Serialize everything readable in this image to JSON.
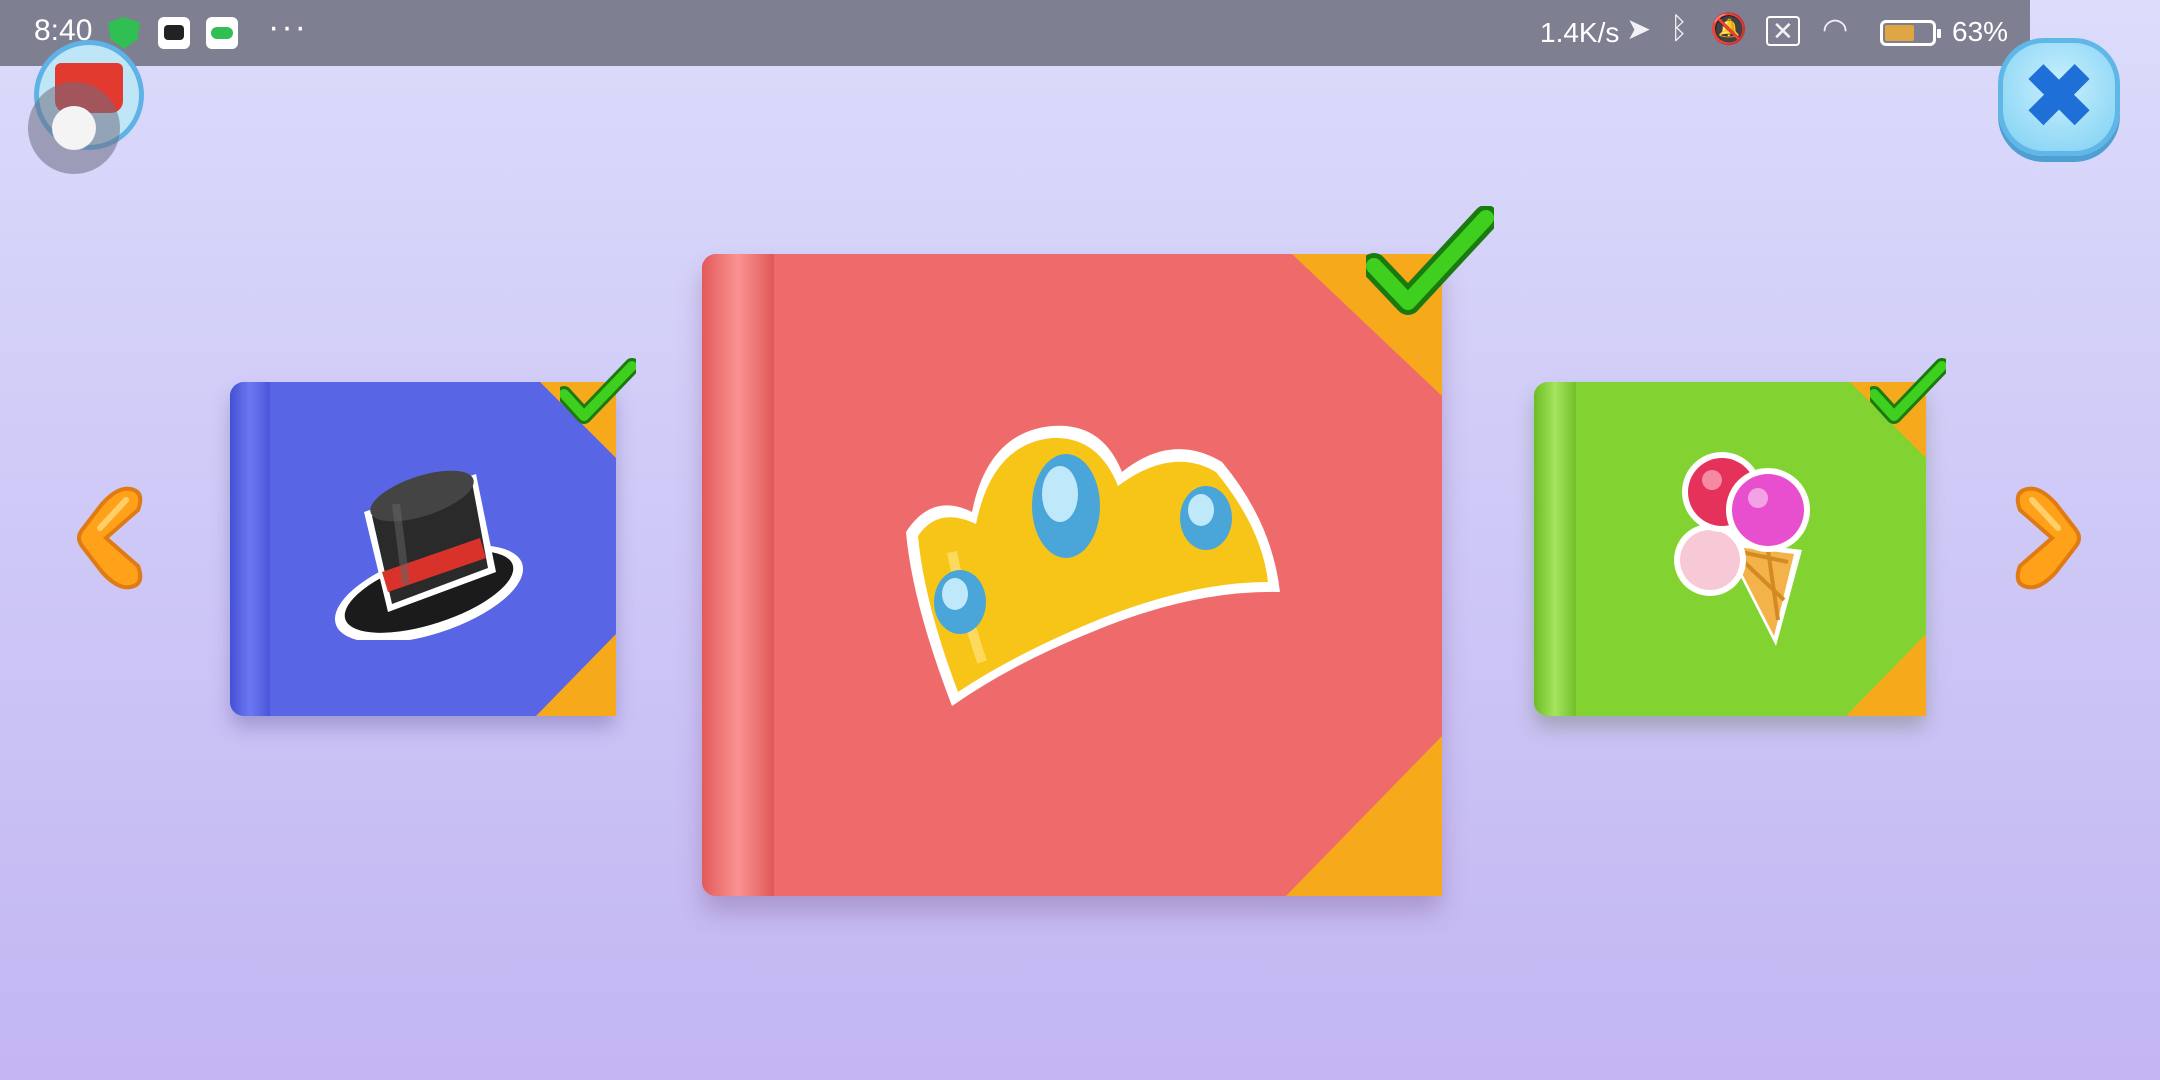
{
  "status_bar": {
    "time": "8:40",
    "more": "···",
    "net_speed": "1.4K/s",
    "battery_percent": "63%",
    "battery_level": 0.63,
    "icons": [
      "shield-icon",
      "camera-icon",
      "toggle-icon",
      "location-icon",
      "bluetooth-icon",
      "bell-muted-icon",
      "sim-off-icon",
      "wifi-icon",
      "battery-icon"
    ]
  },
  "buttons": {
    "close_icon": "close-icon",
    "close_symbol": "✖",
    "prev_icon": "chevron-left-icon",
    "next_icon": "chevron-right-icon",
    "basket_icon": "basket-icon"
  },
  "books": [
    {
      "id": "blue",
      "emblem": "top-hat-icon",
      "color": "#5866e6",
      "completed": true
    },
    {
      "id": "red",
      "emblem": "crown-icon",
      "color": "#ef6b6b",
      "completed": true,
      "selected": true
    },
    {
      "id": "green",
      "emblem": "ice-cream-icon",
      "color": "#82d331",
      "completed": true
    }
  ],
  "colors": {
    "accent_orange": "#f5a91b",
    "check_green": "#3fcf1f",
    "arrow_orange": "#ffa21a"
  }
}
